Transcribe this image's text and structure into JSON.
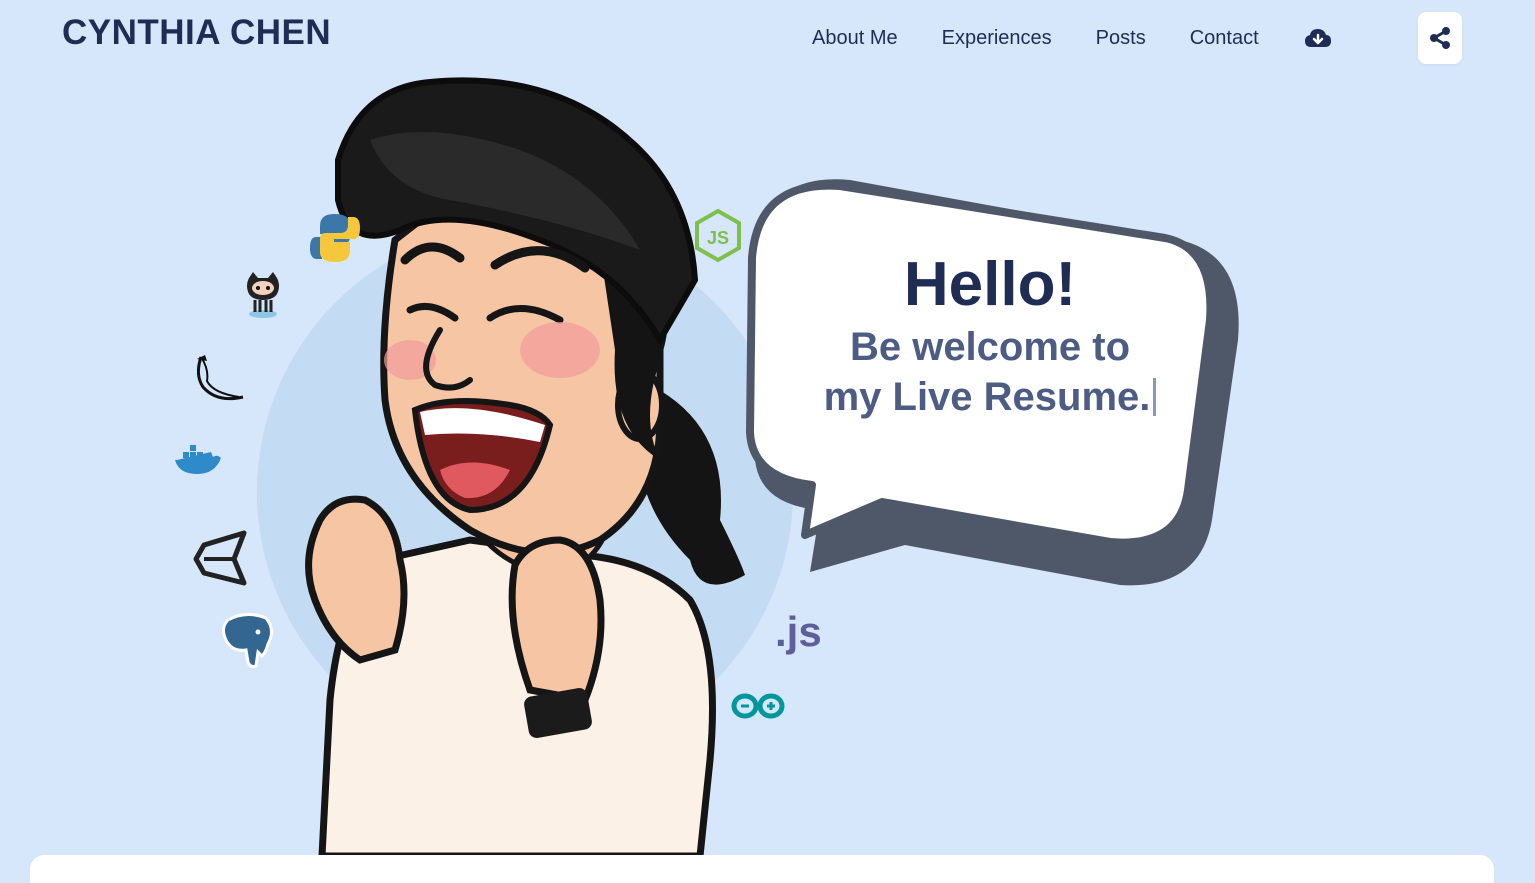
{
  "header": {
    "brand": "CYNTHIA CHEN",
    "nav": [
      {
        "label": "About Me"
      },
      {
        "label": "Experiences"
      },
      {
        "label": "Posts"
      },
      {
        "label": "Contact"
      }
    ],
    "download_icon": "cloud-download-icon",
    "share_icon": "share-icon"
  },
  "hero": {
    "greeting": "Hello!",
    "welcome_line1": "Be welcome to",
    "welcome_line2": "my Live Resume.",
    "tech_icons": [
      "python-icon",
      "github-octocat-icon",
      "flask-icon",
      "docker-icon",
      "unity-icon",
      "postgresql-icon",
      "nodejs-icon",
      "js-icon",
      "arduino-icon"
    ],
    "js_label": ".js"
  },
  "colors": {
    "background": "#d6e6fb",
    "brand": "#1f2d55",
    "accent_text": "#4d5c82",
    "bubble_shadow": "#4f5869"
  }
}
